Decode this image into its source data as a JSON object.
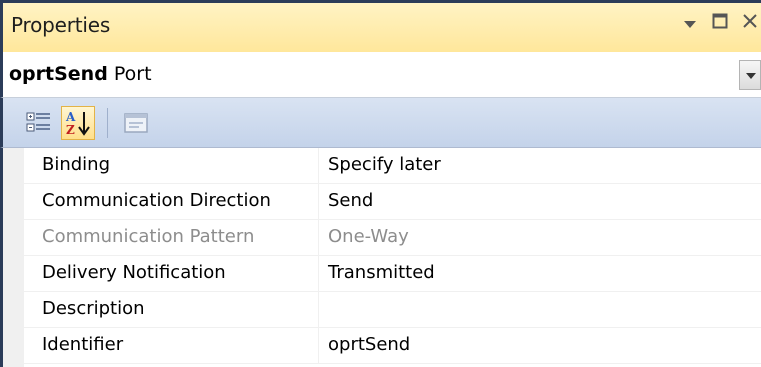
{
  "panel": {
    "title": "Properties"
  },
  "selector": {
    "object_name": "oprtSend",
    "object_type": "Port"
  },
  "toolbar": {
    "buttons": [
      {
        "icon": "categorized-icon"
      },
      {
        "icon": "alphabetical-sort-icon",
        "active": true
      },
      {
        "icon": "property-pages-icon",
        "enabled": false
      }
    ]
  },
  "properties": [
    {
      "name": "Binding",
      "value": "Specify later",
      "disabled": false
    },
    {
      "name": "Communication Direction",
      "value": "Send",
      "disabled": false
    },
    {
      "name": "Communication Pattern",
      "value": "One-Way",
      "disabled": true
    },
    {
      "name": "Delivery Notification",
      "value": "Transmitted",
      "disabled": false
    },
    {
      "name": "Description",
      "value": "",
      "disabled": false
    },
    {
      "name": "Identifier",
      "value": "oprtSend",
      "disabled": false
    }
  ],
  "colors": {
    "title_bar": "#ffe79b",
    "toolbar": "#c4d3ea",
    "window_border": "#2b3c59",
    "disabled_text": "#8d8d8d"
  }
}
